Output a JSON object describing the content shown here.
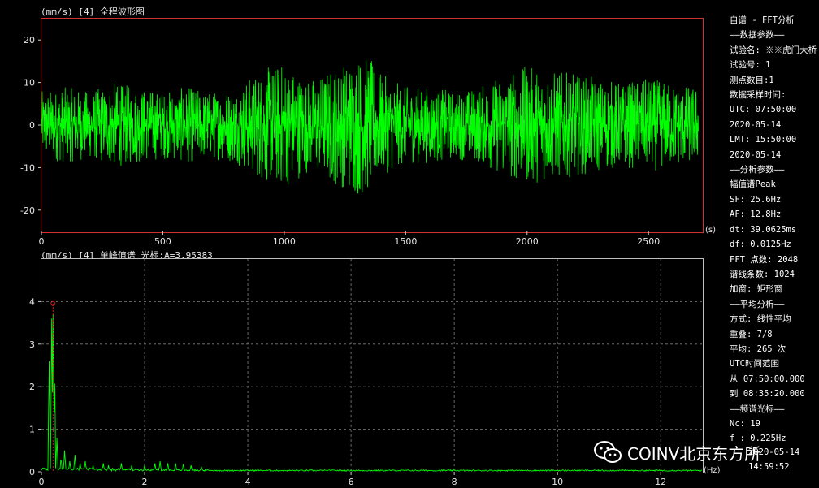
{
  "waveform": {
    "title": "(mm/s) [4] 全程波形图",
    "x_unit": "(s)"
  },
  "spectrum": {
    "title": "(mm/s) [4] 单峰值谱 光标:A=3.95383",
    "x_unit": "(Hz)"
  },
  "info_panel": {
    "lines": [
      "自谱 - FFT分析",
      "——数据参数——",
      "试验名: ※※虎门大桥",
      "试验号: 1",
      "测点数目:1",
      "数据采样时间:",
      "UTC: 07:50:00",
      "   2020-05-14",
      "LMT: 15:50:00",
      "   2020-05-14",
      "——分析参数——",
      "幅值谱Peak",
      "SF: 25.6Hz",
      "AF: 12.8Hz",
      "dt: 39.0625ms",
      "df: 0.0125Hz",
      "FFT 点数: 2048",
      "谱线条数: 1024",
      "加窗: 矩形窗",
      "——平均分析——",
      "方式: 线性平均",
      "重叠: 7/8",
      "平均: 265 次",
      "UTC时间范围",
      "从 07:50:00.000",
      "到 08:35:20.000",
      "——频谱光标——",
      "Nc: 19",
      "f : 0.225Hz"
    ]
  },
  "watermark": {
    "text": "COINV北京东方所",
    "icon": "wechat-icon"
  },
  "timestamp": {
    "line1": "2020-05-14",
    "line2": "14:59:52"
  },
  "colors": {
    "trace": "#00ff00",
    "frame_top": "#d43030",
    "frame_bottom": "#bfbfbf",
    "grid": "#808080",
    "cursor": "#cc2020"
  },
  "chart_data": [
    {
      "type": "line",
      "title": "(mm/s) [4] 全程波形图",
      "xlabel": "(s)",
      "ylabel": "(mm/s)",
      "xlim": [
        0,
        2720
      ],
      "ylim": [
        -25,
        25
      ],
      "x_ticks": [
        0,
        500,
        1000,
        1500,
        2000,
        2500
      ],
      "y_ticks": [
        20,
        10,
        0,
        -10,
        -20
      ],
      "grid": false,
      "series": [
        {
          "envelope_x": [
            0,
            100,
            200,
            300,
            400,
            500,
            600,
            700,
            800,
            900,
            1000,
            1100,
            1150,
            1200,
            1250,
            1300,
            1350,
            1400,
            1500,
            1600,
            1700,
            1800,
            1900,
            2000,
            2100,
            2200,
            2300,
            2400,
            2500,
            2600,
            2700
          ],
          "envelope_amp": [
            8,
            9,
            8,
            10,
            9,
            8,
            9,
            8,
            9,
            13,
            15,
            11,
            12,
            14,
            15,
            17,
            16,
            12,
            9,
            9,
            8,
            9,
            12,
            14,
            13,
            12,
            11,
            10,
            11,
            10,
            9
          ]
        }
      ]
    },
    {
      "type": "line",
      "title": "(mm/s) [4] 单峰值谱 光标:A=3.95383",
      "xlabel": "(Hz)",
      "ylabel": "(mm/s)",
      "xlim": [
        0,
        12.8
      ],
      "ylim": [
        0,
        5
      ],
      "x_ticks": [
        0,
        2,
        4,
        6,
        8,
        10,
        12
      ],
      "y_ticks": [
        0,
        1,
        2,
        3,
        4
      ],
      "grid": true,
      "cursor": {
        "f": 0.225,
        "A": 3.95383
      },
      "series": [
        {
          "peaks_f": [
            0.15,
            0.2,
            0.225,
            0.26,
            0.3,
            0.38,
            0.45,
            0.55,
            0.65,
            0.75,
            0.85,
            1.0,
            1.2,
            1.3,
            1.55,
            1.75,
            2.0,
            2.2,
            2.3,
            2.45,
            2.6,
            2.75,
            2.9,
            3.1
          ],
          "peaks_a": [
            2.6,
            3.6,
            3.7,
            2.3,
            0.8,
            0.35,
            0.5,
            0.25,
            0.4,
            0.2,
            0.25,
            0.15,
            0.2,
            0.15,
            0.2,
            0.15,
            0.15,
            0.2,
            0.25,
            0.2,
            0.2,
            0.18,
            0.15,
            0.12
          ]
        }
      ]
    }
  ]
}
